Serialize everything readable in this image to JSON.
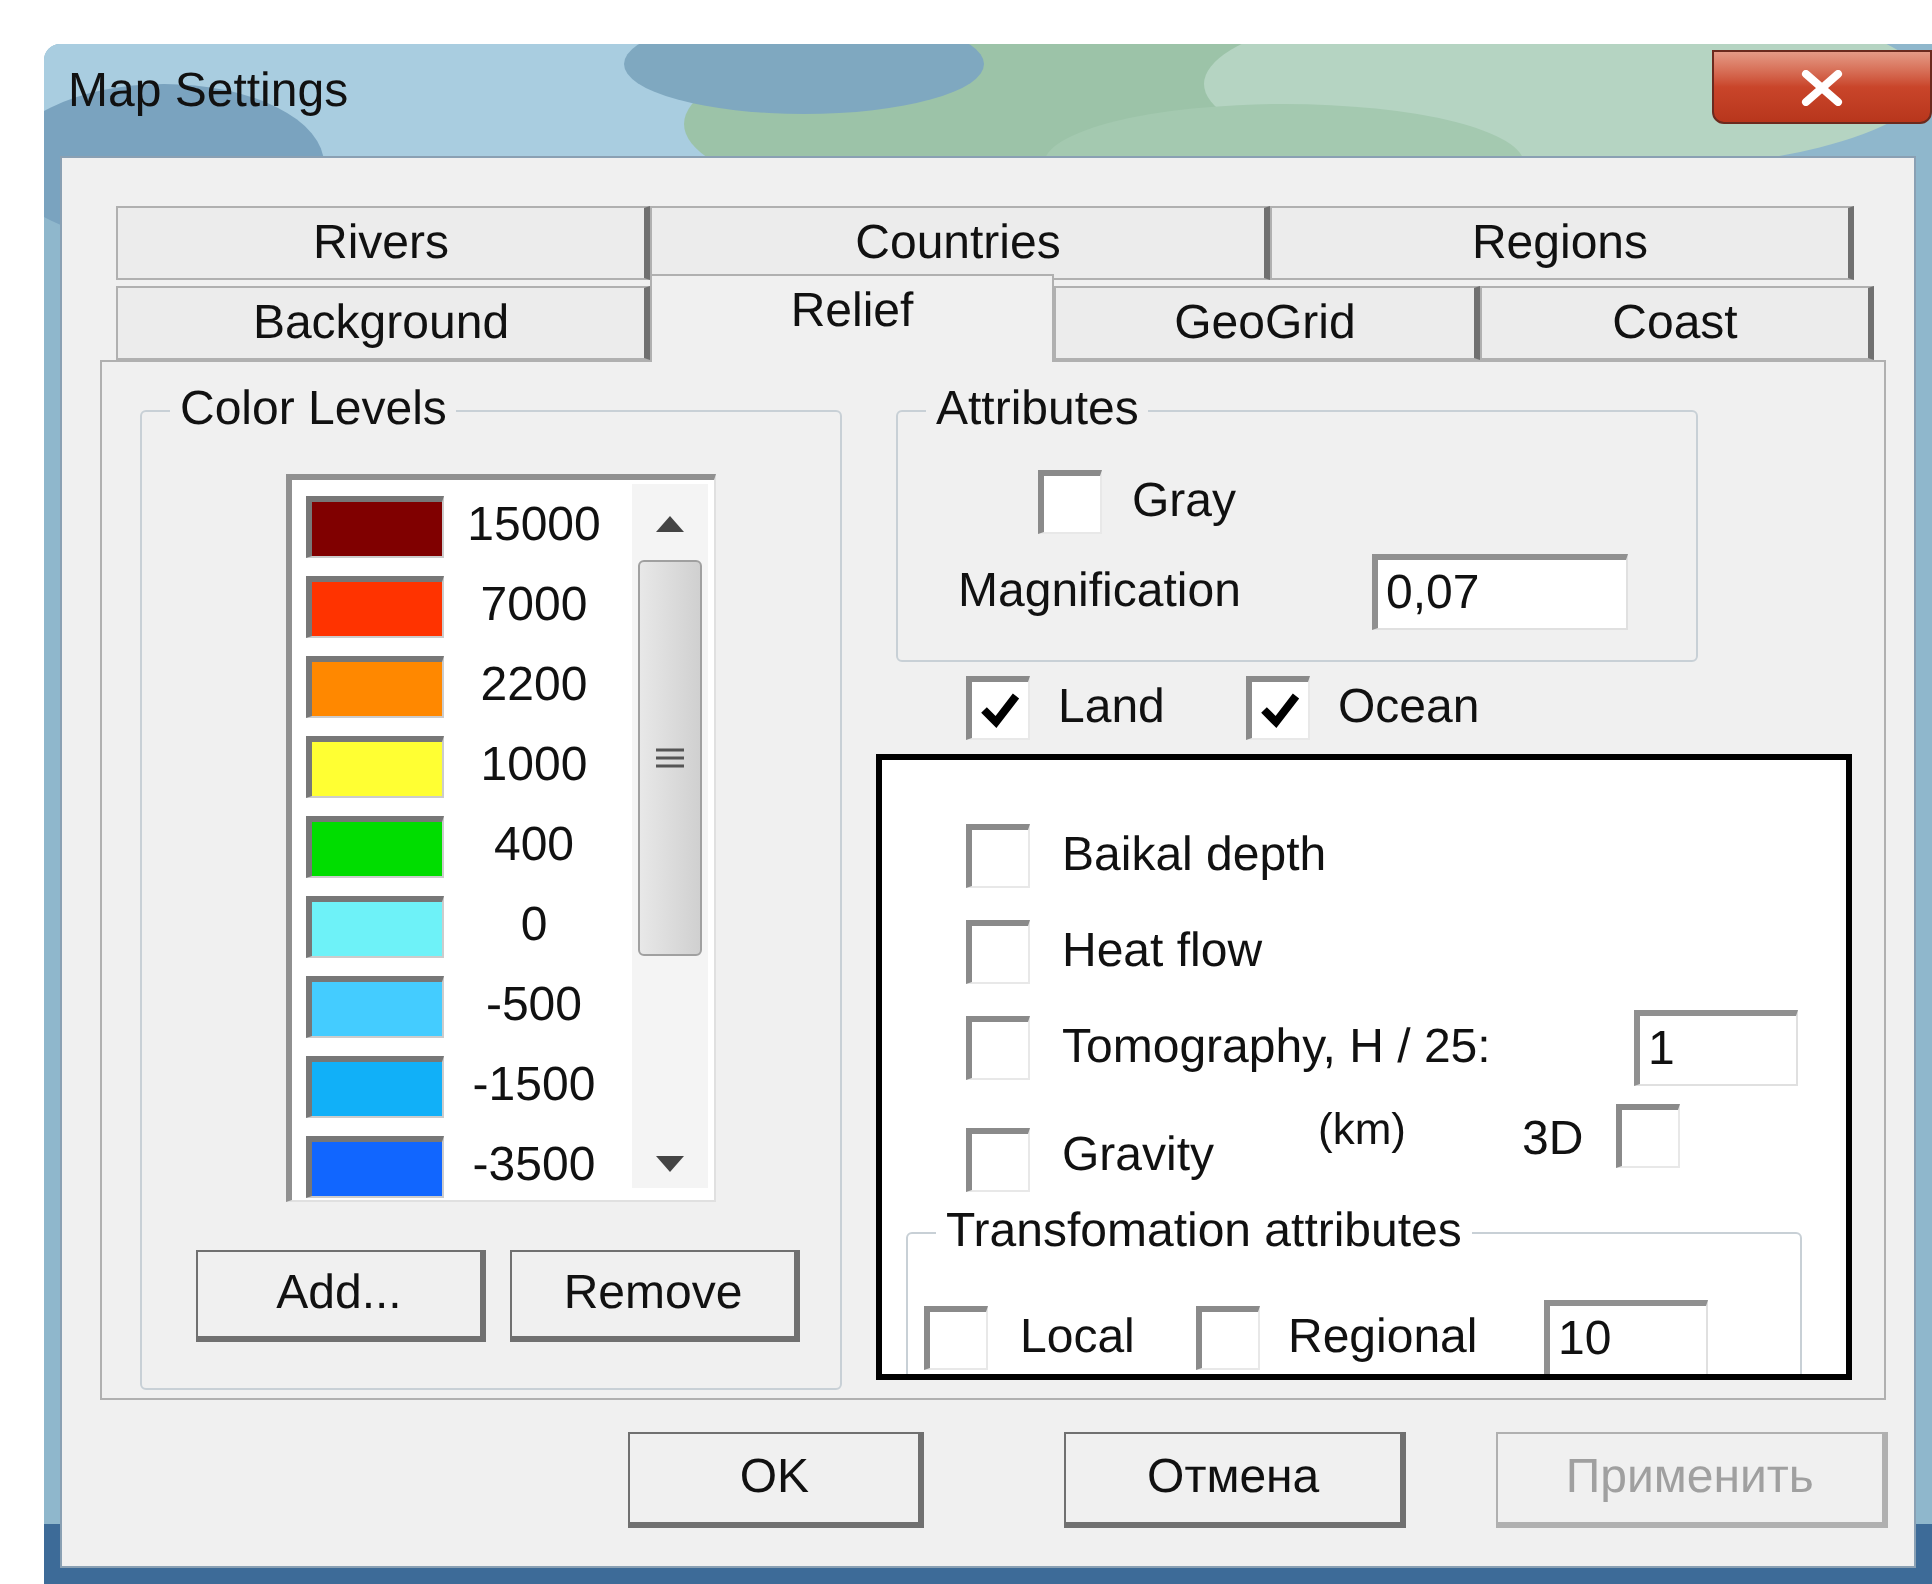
{
  "window": {
    "title": "Map Settings"
  },
  "tab_rows": [
    [
      {
        "label": "Rivers",
        "selected": false
      },
      {
        "label": "Countries",
        "selected": false
      },
      {
        "label": "Regions",
        "selected": false
      }
    ],
    [
      {
        "label": "Background",
        "selected": false
      },
      {
        "label": "Relief",
        "selected": true
      },
      {
        "label": "GeoGrid",
        "selected": false
      },
      {
        "label": "Coast",
        "selected": false
      }
    ]
  ],
  "color_levels": {
    "title": "Color Levels",
    "items": [
      {
        "value": "15000",
        "color": "#800000"
      },
      {
        "value": "7000",
        "color": "#ff3300"
      },
      {
        "value": "2200",
        "color": "#ff8800"
      },
      {
        "value": "1000",
        "color": "#ffff33"
      },
      {
        "value": "400",
        "color": "#00dd00"
      },
      {
        "value": "0",
        "color": "#6ef2f8"
      },
      {
        "value": "-500",
        "color": "#44ccff"
      },
      {
        "value": "-1500",
        "color": "#11b0f8"
      },
      {
        "value": "-3500",
        "color": "#1166ff"
      }
    ],
    "buttons": [
      {
        "label": "Add..."
      },
      {
        "label": "Remove"
      }
    ]
  },
  "attributes": {
    "title": "Attributes",
    "gray": {
      "label": "Gray",
      "checked": false
    },
    "magnification": {
      "label": "Magnification",
      "value": "0,07"
    }
  },
  "land": {
    "label": "Land",
    "checked": true
  },
  "ocean": {
    "label": "Ocean",
    "checked": true
  },
  "layers": [
    {
      "label": "Baikal depth",
      "checked": false
    },
    {
      "label": "Heat flow",
      "checked": false
    },
    {
      "label": "Tomography, H / 25:",
      "checked": false
    },
    {
      "label": "Gravity",
      "checked": false
    }
  ],
  "tomography": {
    "value": "1",
    "unit": "(km)",
    "three_d": {
      "label": "3D",
      "checked": false
    }
  },
  "transformation": {
    "title": "Transfomation attributes",
    "local": {
      "label": "Local",
      "checked": false
    },
    "regional": {
      "label": "Regional",
      "checked": false
    },
    "value": "10"
  },
  "buttons": [
    {
      "label": "OK",
      "disabled": false
    },
    {
      "label": "Отмена",
      "disabled": false
    },
    {
      "label": "Применить",
      "disabled": true
    }
  ]
}
